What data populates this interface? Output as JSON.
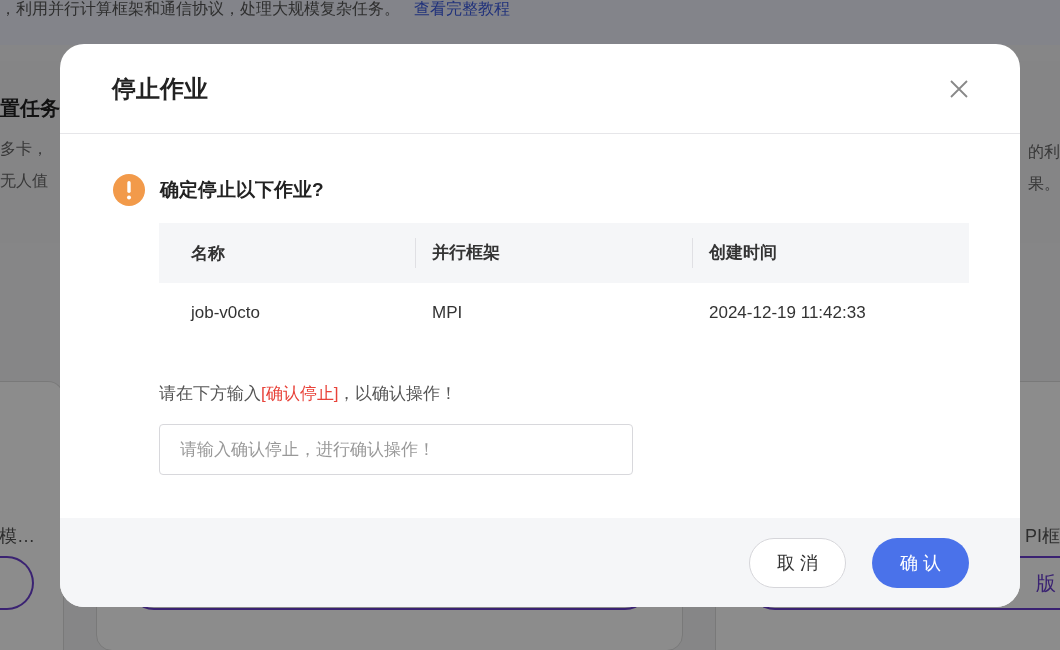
{
  "background": {
    "intro": "，利用并行计算框架和通信协议，处理大规模复杂任务。",
    "tutorial_link": "查看完整教程",
    "section_title": "置任务",
    "section_left_lines": [
      "多卡，",
      "无人值"
    ],
    "section_right_lines": [
      "的利",
      "果。"
    ],
    "card_texts": [
      "模…",
      "PI框"
    ],
    "card_button_text": "版"
  },
  "dialog": {
    "title": "停止作业",
    "question": "确定停止以下作业?",
    "table": {
      "columns": [
        "名称",
        "并行框架",
        "创建时间"
      ],
      "rows": [
        [
          "job-v0cto",
          "MPI",
          "2024-12-19 11:42:33"
        ]
      ]
    },
    "prompt": {
      "before": "请在下方输入",
      "highlight": "[确认停止]",
      "after": "，以确认操作！"
    },
    "input": {
      "placeholder": "请输入确认停止，进行确认操作！"
    },
    "buttons": [
      {
        "label": "取 消",
        "kind": "secondary"
      },
      {
        "label": "确 认",
        "kind": "primary"
      }
    ]
  }
}
